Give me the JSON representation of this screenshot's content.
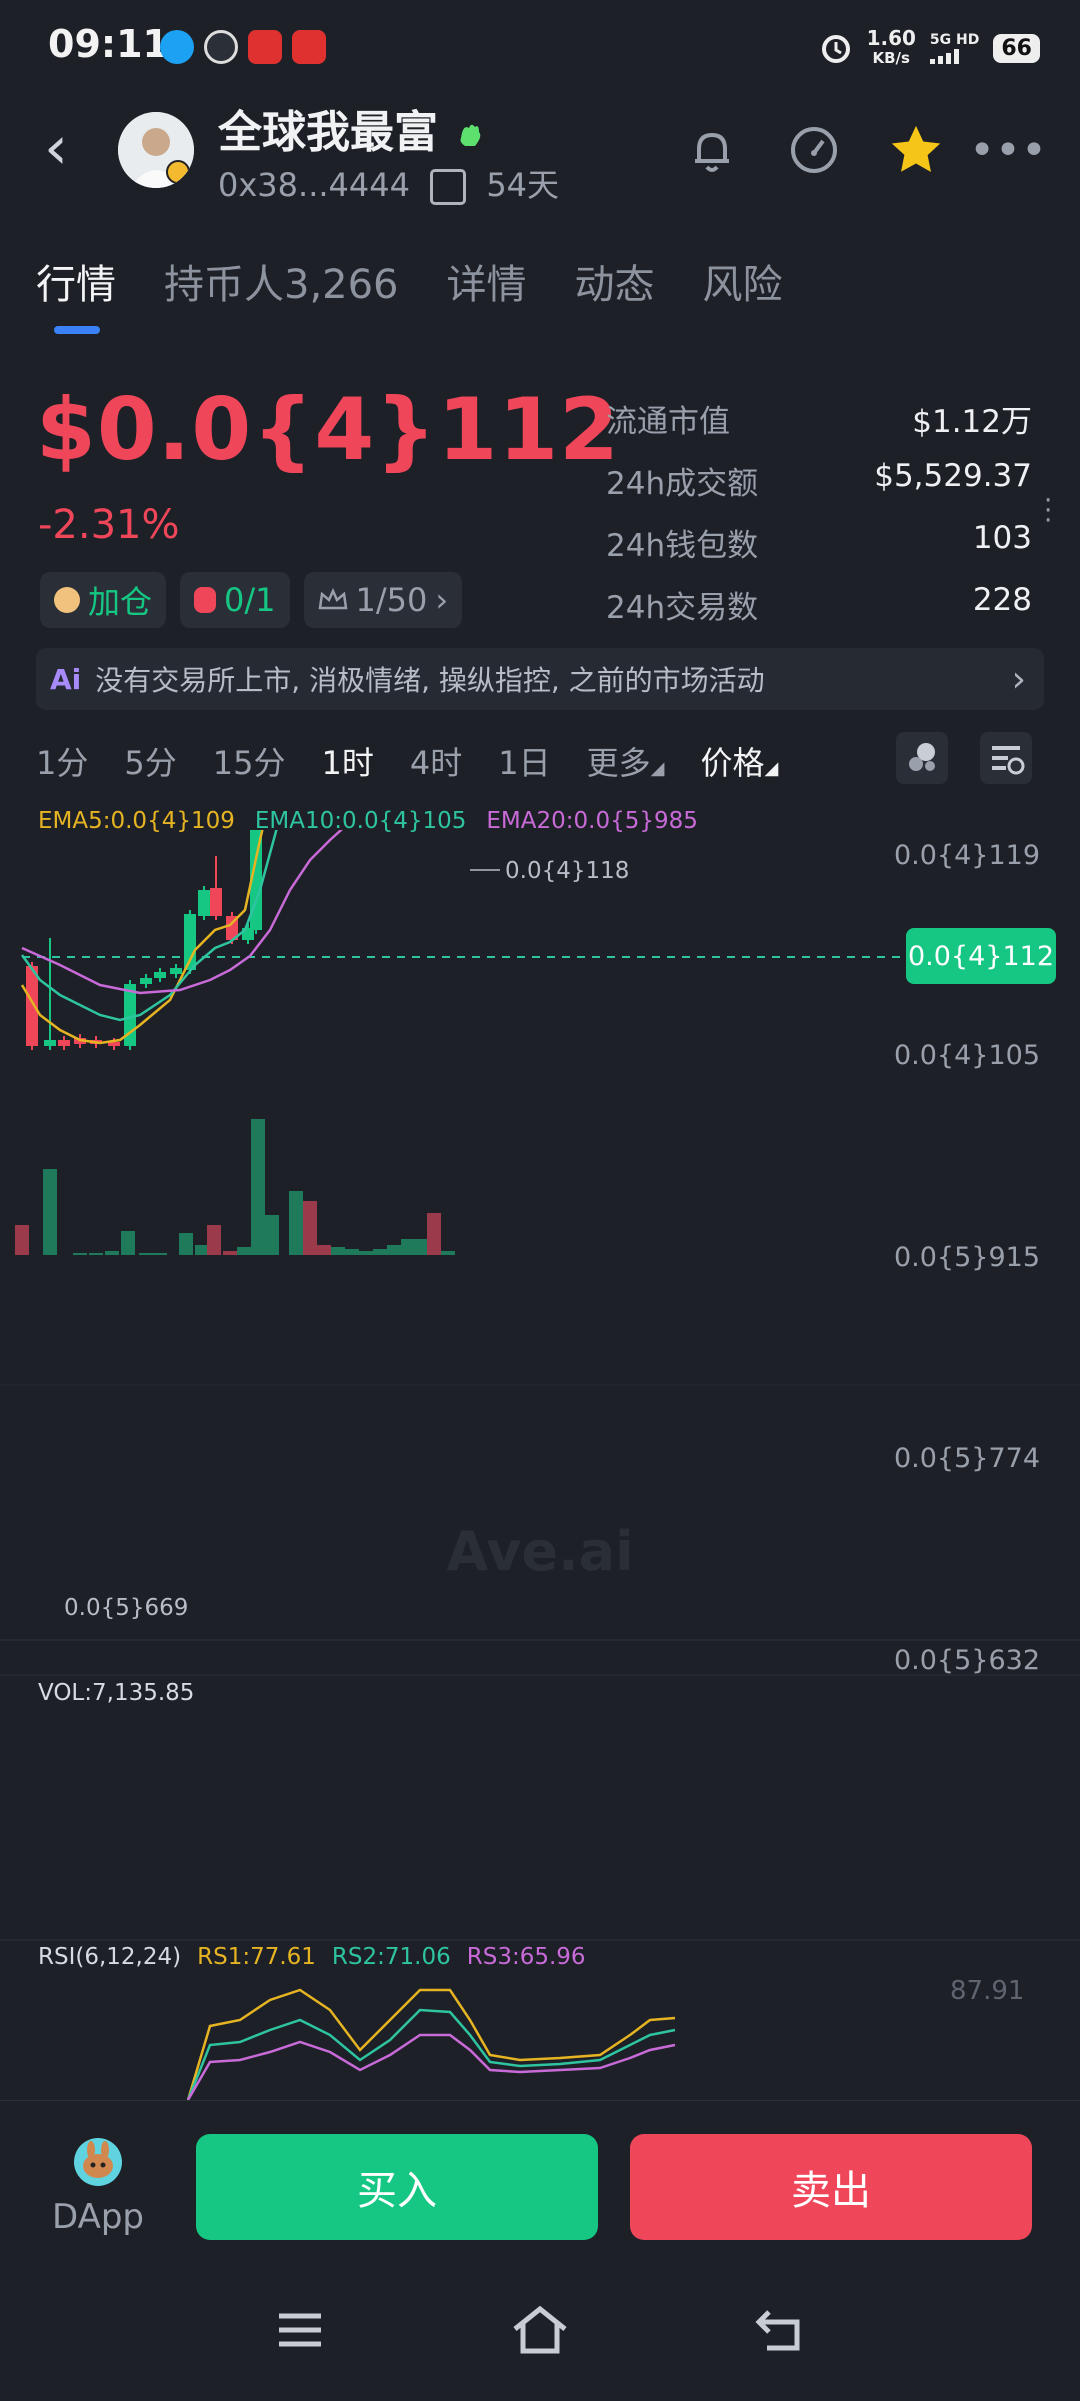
{
  "status": {
    "time": "09:11",
    "net_speed": "1.60",
    "net_unit": "KB/s",
    "signal": "5G HD",
    "battery": "66"
  },
  "header": {
    "name": "全球我最富",
    "address": "0x38...4444",
    "age": "54天"
  },
  "tabs": [
    "行情",
    "持币人3,266",
    "详情",
    "动态",
    "风险"
  ],
  "price": {
    "value": "$0.0{4}112",
    "change": "-2.31%"
  },
  "chips": {
    "add": "加仓",
    "ratio": "0/1",
    "rank": "1/50"
  },
  "stats": [
    {
      "label": "流通市值",
      "value": "$1.12万"
    },
    {
      "label": "24h成交额",
      "value": "$5,529.37"
    },
    {
      "label": "24h钱包数",
      "value": "103"
    },
    {
      "label": "24h交易数",
      "value": "228"
    }
  ],
  "ai": {
    "badge": "Ai",
    "text": "没有交易所上市, 消极情绪, 操纵指控, 之前的市场活动"
  },
  "intervals": [
    "1分",
    "5分",
    "15分",
    "1时",
    "4时",
    "1日",
    "更多",
    "价格"
  ],
  "ema": {
    "ema5": "EMA5:0.0{4}109",
    "ema10": "EMA10:0.0{4}105",
    "ema20": "EMA20:0.0{5}985"
  },
  "y_axis": [
    "0.0{4}119",
    "0.0{4}105",
    "0.0{5}915",
    "0.0{5}774",
    "0.0{5}632"
  ],
  "markers": {
    "high": "0.0{4}118",
    "low": "0.0{5}669",
    "current": "0.0{4}112"
  },
  "watermark": "Ave.ai",
  "vol": {
    "label": "VOL:7,135.85"
  },
  "rsi": {
    "label": "RSI(6,12,24)",
    "rs1": "RS1:77.61",
    "rs2": "RS2:71.06",
    "rs3": "RS3:65.96",
    "top": "87.91"
  },
  "bottom": {
    "dapp": "DApp",
    "buy": "买入",
    "sell": "卖出"
  },
  "colors": {
    "up": "#16c784",
    "down": "#f0465a",
    "accent": "#3b82f6",
    "star": "#f5c518"
  }
}
